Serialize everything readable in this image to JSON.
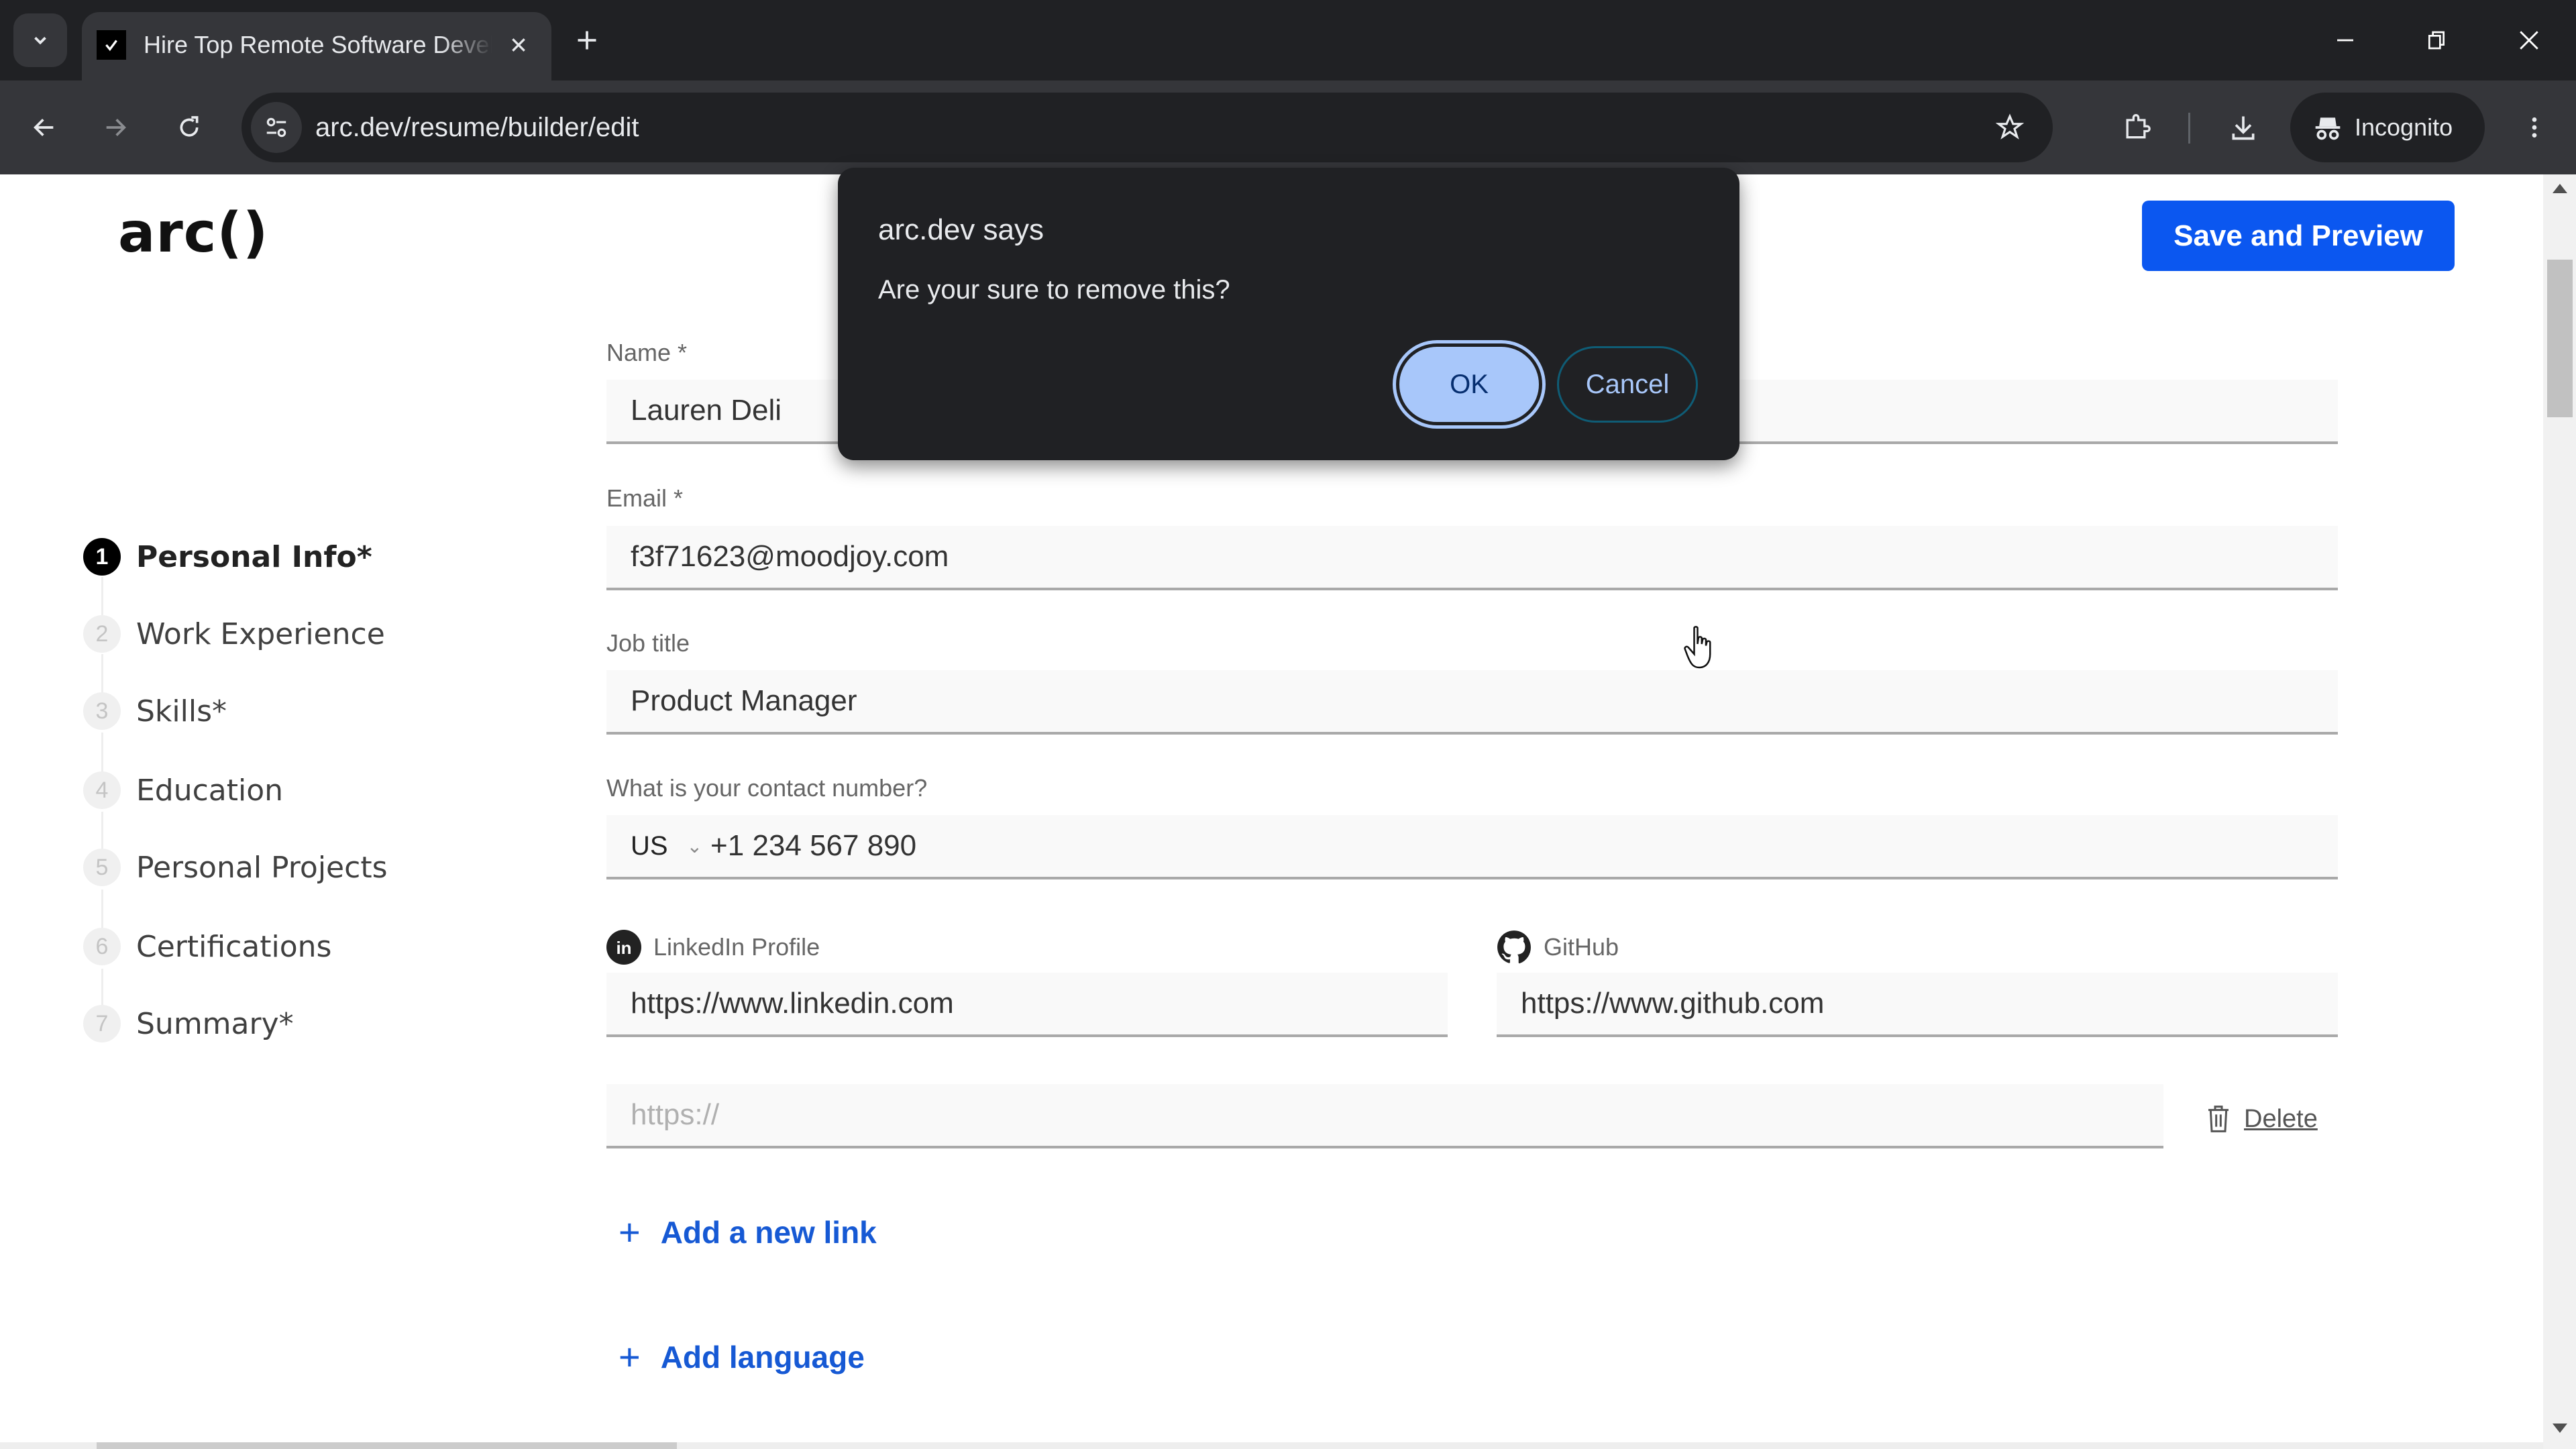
{
  "browser": {
    "tab_title": "Hire Top Remote Software Developers",
    "url": "arc.dev/resume/builder/edit",
    "incognito_label": "Incognito",
    "colors": {
      "tabstrip": "#202124",
      "toolbar": "#35363a"
    }
  },
  "header": {
    "logo": "arc()",
    "save_preview_label": "Save and Preview",
    "accent_color": "#0b57f0"
  },
  "steps": [
    {
      "num": "1",
      "label": "Personal Info*",
      "active": true
    },
    {
      "num": "2",
      "label": "Work Experience",
      "active": false
    },
    {
      "num": "3",
      "label": "Skills*",
      "active": false
    },
    {
      "num": "4",
      "label": "Education",
      "active": false
    },
    {
      "num": "5",
      "label": "Personal Projects",
      "active": false
    },
    {
      "num": "6",
      "label": "Certifications",
      "active": false
    },
    {
      "num": "7",
      "label": "Summary*",
      "active": false
    }
  ],
  "form": {
    "name": {
      "label": "Name *",
      "value": "Lauren Deli"
    },
    "email": {
      "label": "Email *",
      "value": "f3f71623@moodjoy.com"
    },
    "job_title": {
      "label": "Job title",
      "value": "Product Manager"
    },
    "contact": {
      "label": "What is your contact number?",
      "country": "US",
      "value": "+1 234 567 890"
    },
    "linkedin": {
      "label": "LinkedIn Profile",
      "value": "https://www.linkedin.com"
    },
    "github": {
      "label": "GitHub",
      "value": "https://www.github.com"
    },
    "extra_link": {
      "placeholder": "https://",
      "value": ""
    },
    "delete_label": "Delete",
    "add_link_label": "Add a new link",
    "add_language_label": "Add language",
    "link_color": "#1659d4"
  },
  "dialog": {
    "title": "arc.dev says",
    "message": "Are your sure to remove this?",
    "ok_label": "OK",
    "cancel_label": "Cancel"
  }
}
